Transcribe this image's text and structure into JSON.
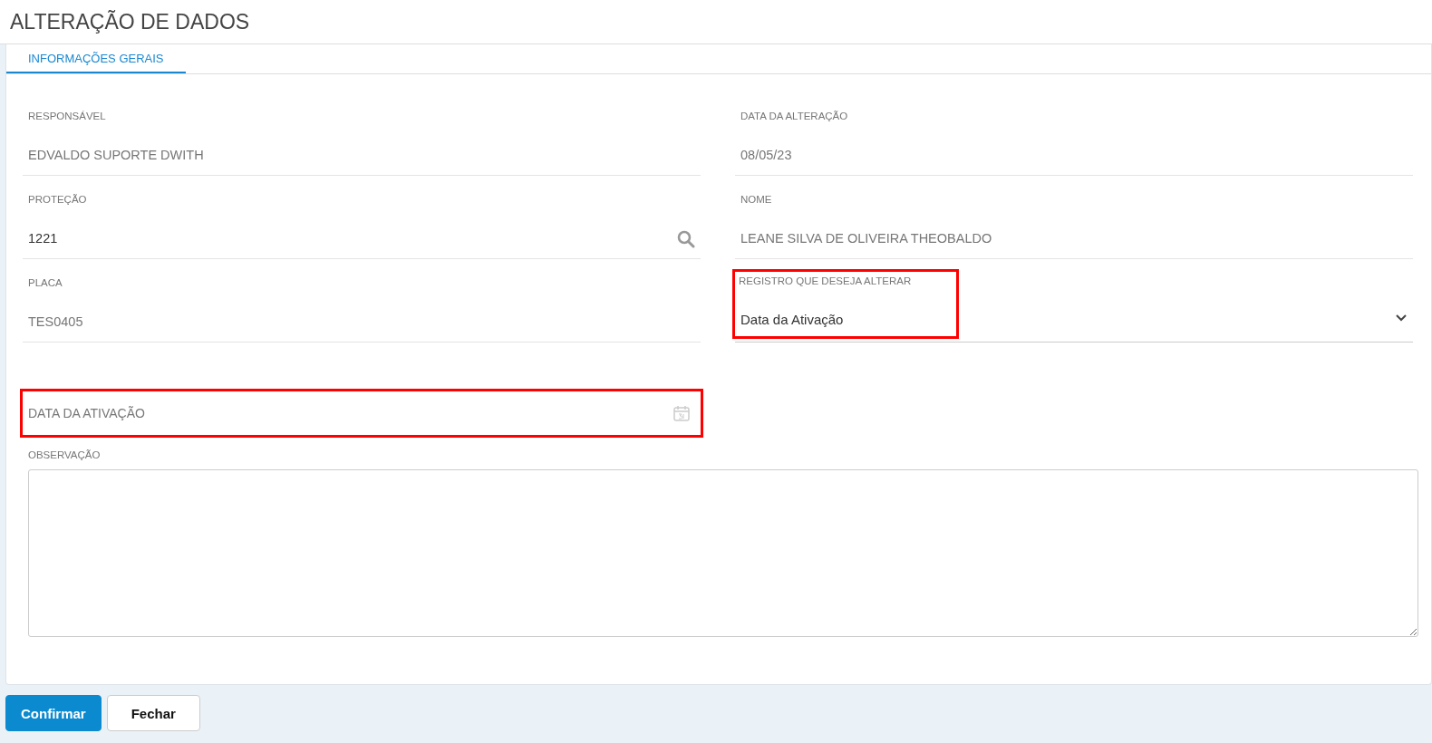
{
  "window": {
    "title": "ALTERAÇÃO DE DADOS"
  },
  "tabs": [
    {
      "label": "INFORMAÇÕES GERAIS",
      "selected": true
    }
  ],
  "fields": [
    {
      "kind": "text",
      "label": "RESPONSÁVEL",
      "value": "EDVALDO SUPORTE DWITH",
      "highlighted": false
    },
    {
      "kind": "text",
      "label": "DATA DA ALTERAÇÃO",
      "value": "08/05/23",
      "highlighted": false
    },
    {
      "kind": "search",
      "label": "PROTEÇÃO",
      "value": "1221",
      "highlighted": false
    },
    {
      "kind": "text",
      "label": "NOME",
      "value": "LEANE SILVA DE OLIVEIRA THEOBALDO",
      "highlighted": false
    },
    {
      "kind": "text",
      "label": "PLACA",
      "value": "TES0405",
      "highlighted": false
    },
    {
      "kind": "select",
      "label": "REGISTRO QUE DESEJA ALTERAR",
      "value": "Data da Ativação",
      "highlighted": true
    },
    {
      "kind": "date",
      "placeholder": "DATA DA ATIVAÇÃO",
      "highlighted": true
    },
    {
      "kind": "textarea",
      "label": "OBSERVAÇÃO",
      "highlighted": false
    }
  ],
  "buttons": [
    {
      "label": "Confirmar",
      "kind": "primary"
    },
    {
      "label": "Fechar",
      "kind": "secondary"
    }
  ]
}
